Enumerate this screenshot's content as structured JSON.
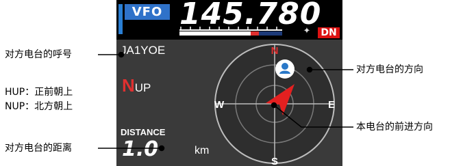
{
  "display": {
    "mode_badge": "VFO",
    "frequency": "145.780",
    "digital_mode": "DN",
    "callsign": "JA1YOE",
    "orientation_main": "N",
    "orientation_suffix": "UP",
    "distance_label": "DISTANCE",
    "distance_value": "1.0",
    "distance_unit": "km",
    "compass": {
      "north": "N",
      "south": "S",
      "east": "E",
      "west": "W"
    },
    "icons": {
      "gps": "gps-signal-icon",
      "station": "person-icon",
      "heading": "heading-arrow-icon"
    }
  },
  "annotations": {
    "callsign": "对方电台的呼号",
    "hup": "HUP：正前朝上",
    "nup": "NUP：北方朝上",
    "distance": "对方电台的距离",
    "direction": "对方电台的方向",
    "heading": "本电台的前进方向"
  },
  "colors": {
    "vfo_blue": "#2f72c9",
    "accent_red": "#e03030",
    "panel_gray": "#3a3a3a",
    "station_blue": "#2a78c8"
  }
}
